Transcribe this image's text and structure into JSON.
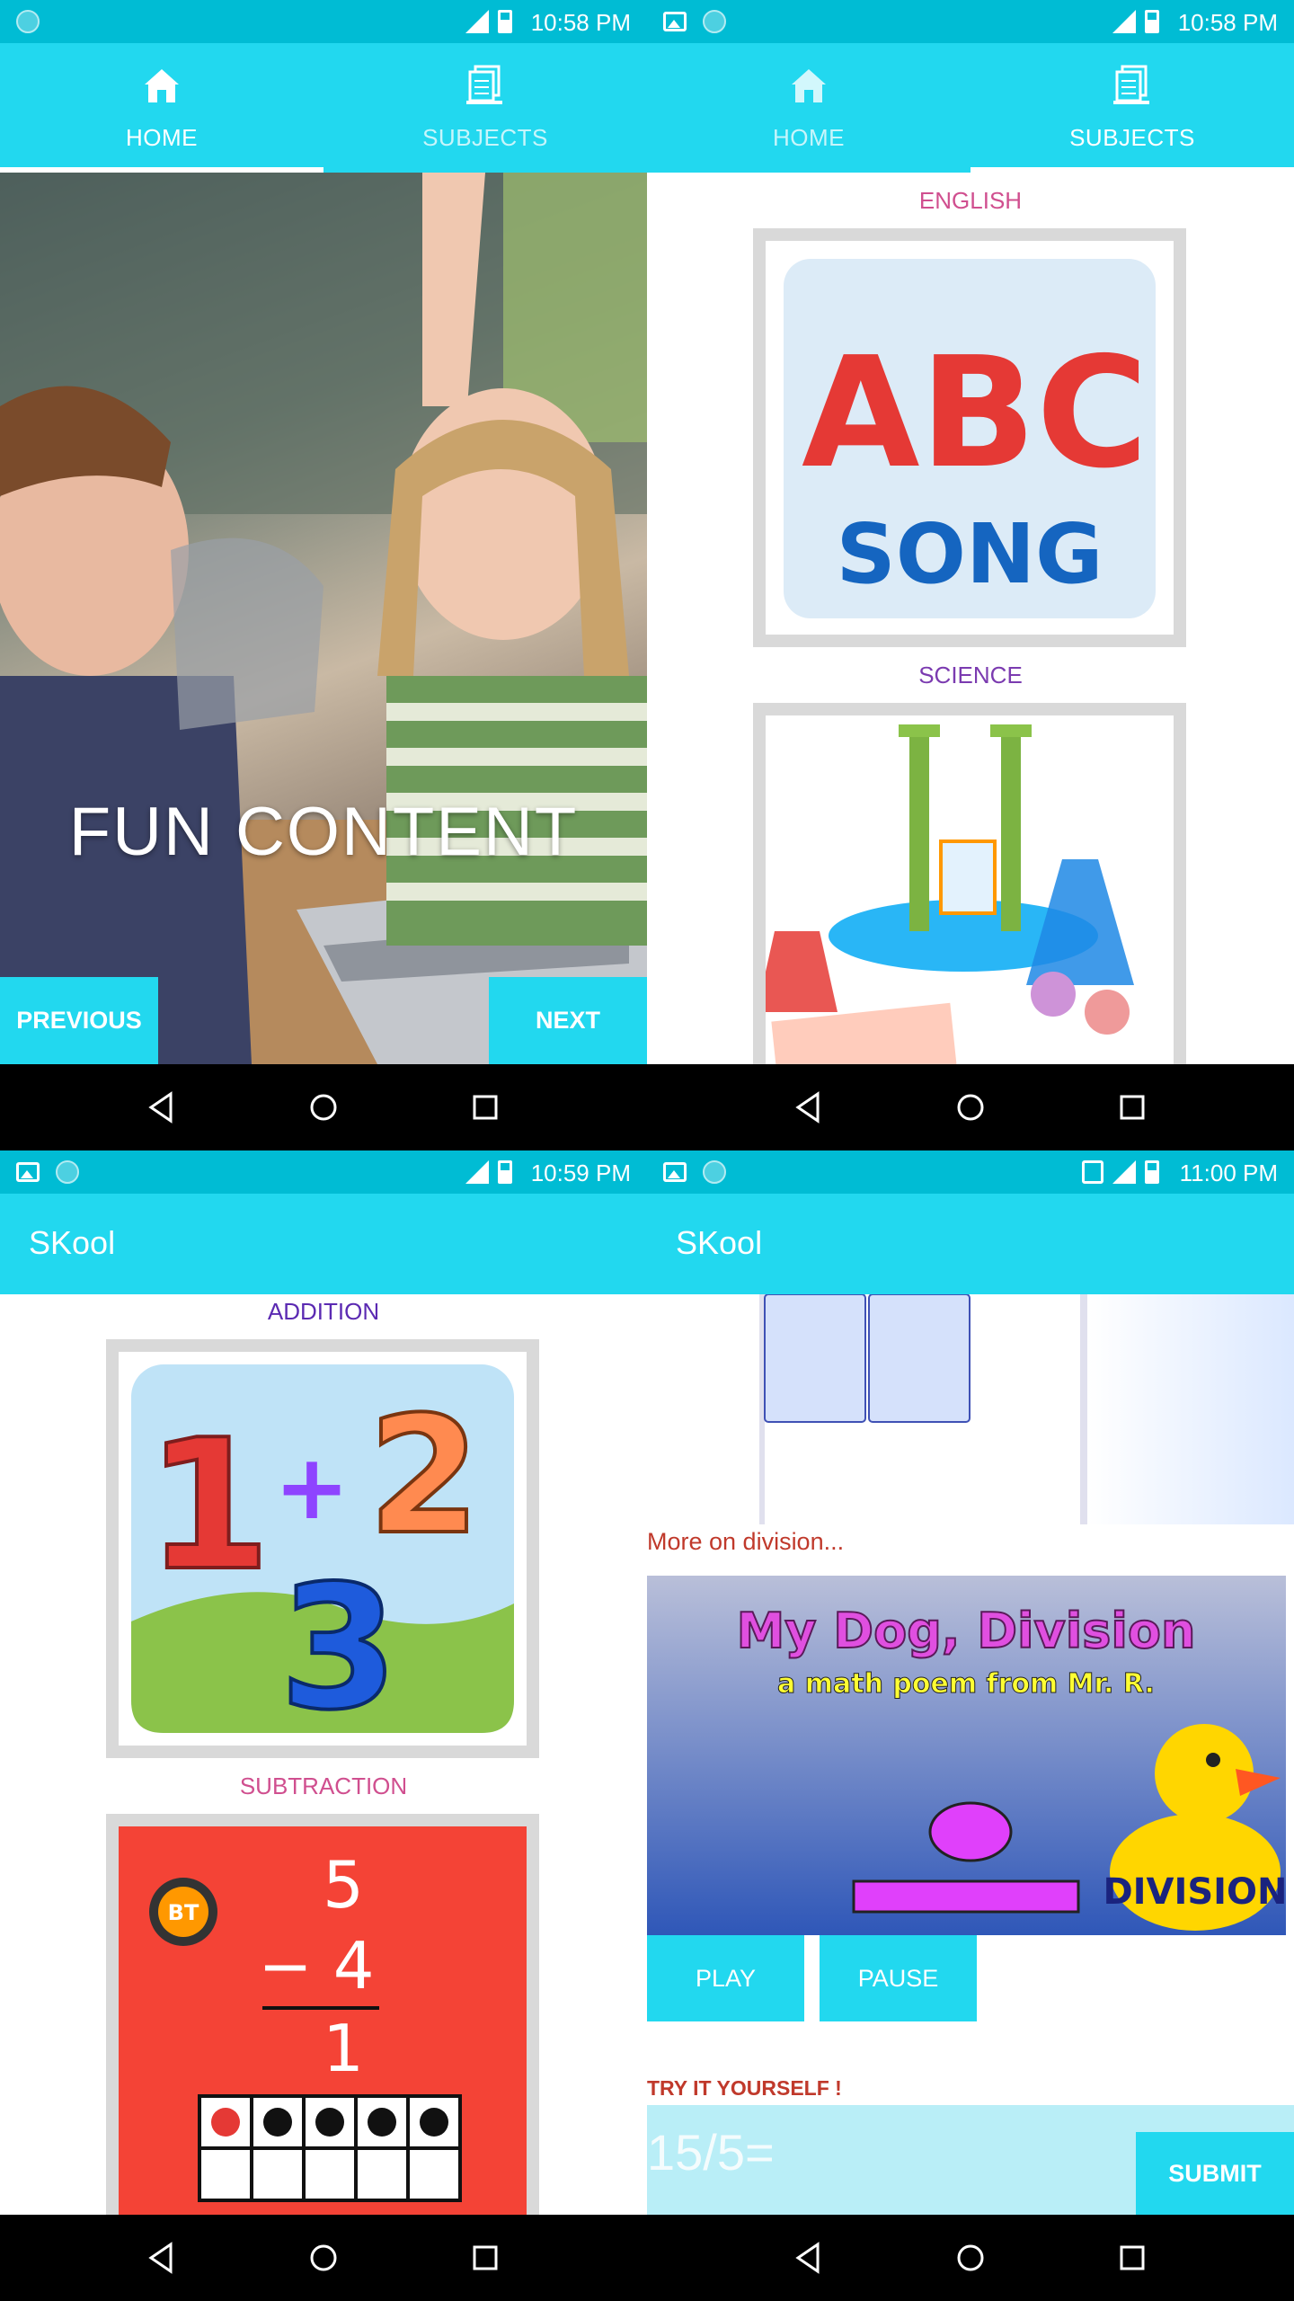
{
  "screens": [
    {
      "status": {
        "time": "10:58 PM"
      },
      "tabs": [
        {
          "label": "HOME"
        },
        {
          "label": "SUBJECTS"
        }
      ],
      "hero": {
        "caption": "FUN CONTENT"
      },
      "buttons": {
        "previous": "PREVIOUS",
        "next": "NEXT"
      }
    },
    {
      "status": {
        "time": "10:58 PM"
      },
      "tabs": [
        {
          "label": "HOME"
        },
        {
          "label": "SUBJECTS"
        }
      ],
      "subjects": [
        {
          "label": "ENGLISH",
          "color": "#d04f8f",
          "image_text": [
            "ABC",
            "SONG"
          ]
        },
        {
          "label": "SCIENCE",
          "color": "#7b3bb0"
        }
      ]
    },
    {
      "status": {
        "time": "10:59 PM"
      },
      "app_title": "SKool",
      "topics": [
        {
          "label": "ADDITION",
          "color": "#5b2ab2",
          "image_text": [
            "1",
            "+",
            "2",
            "3"
          ]
        },
        {
          "label": "SUBTRACTION",
          "color": "#d04f8f",
          "image_text": [
            "BT",
            "5",
            "− 4",
            "1"
          ]
        }
      ]
    },
    {
      "status": {
        "time": "11:00 PM"
      },
      "app_title": "SKool",
      "more_link": "More on division...",
      "video": {
        "title": "My Dog, Division",
        "subtitle": "a math poem from Mr. R.",
        "badge": "DIVISION"
      },
      "controls": {
        "play": "PLAY",
        "pause": "PAUSE"
      },
      "try_label": "TRY IT YOURSELF !",
      "answer": {
        "placeholder": "15/5=",
        "submit": "SUBMIT"
      }
    }
  ],
  "colors": {
    "accent": "#22d8ef",
    "status_bar": "#00bcd4",
    "link_red": "#c0392b"
  }
}
